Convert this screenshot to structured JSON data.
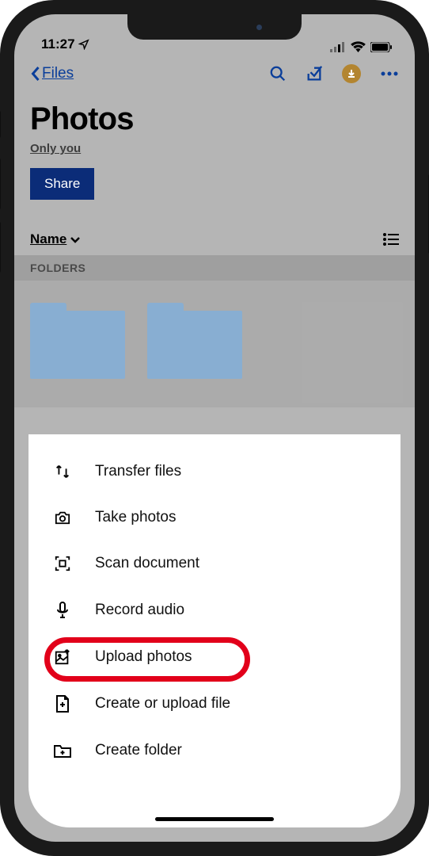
{
  "status": {
    "time": "11:27"
  },
  "nav": {
    "back_label": "Files"
  },
  "page": {
    "title": "Photos",
    "subtitle": "Only you",
    "share_label": "Share"
  },
  "sort": {
    "label": "Name"
  },
  "section": {
    "folders_label": "FOLDERS"
  },
  "sheet": {
    "items": [
      {
        "label": "Transfer files"
      },
      {
        "label": "Take photos"
      },
      {
        "label": "Scan document"
      },
      {
        "label": "Record audio"
      },
      {
        "label": "Upload photos"
      },
      {
        "label": "Create or upload file"
      },
      {
        "label": "Create folder"
      }
    ]
  },
  "highlight_index": 4
}
